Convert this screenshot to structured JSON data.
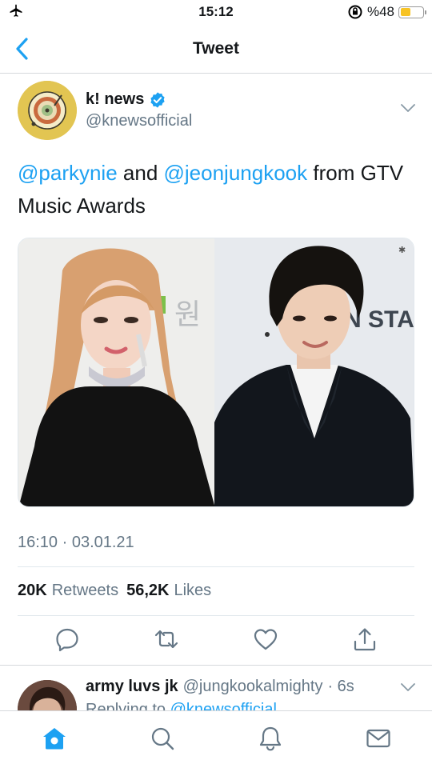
{
  "status_bar": {
    "time": "15:12",
    "battery_text": "%48",
    "battery_level": 0.48,
    "icons": [
      "airplane-icon",
      "rotation-lock-icon",
      "battery-icon"
    ]
  },
  "nav": {
    "title": "Tweet",
    "back_icon": "chevron-left-icon"
  },
  "tweet": {
    "author_name": "k! news",
    "author_handle": "@knewsofficial",
    "verified": true,
    "text_parts": [
      {
        "text": "@parkynie",
        "mention": true
      },
      {
        "text": " and ",
        "mention": false
      },
      {
        "text": "@jeonjungkook",
        "mention": true
      },
      {
        "text": " from GTV Music Awards",
        "mention": false
      }
    ],
    "timestamp": "16:10 · 03.01.21",
    "retweets_count": "20K",
    "retweets_label": "Retweets",
    "likes_count": "56,2K",
    "likes_label": "Likes",
    "photo_left_sign": "원",
    "photo_right_sign": "N STA"
  },
  "actions": [
    "reply-icon",
    "retweet-icon",
    "like-icon",
    "share-icon"
  ],
  "reply": {
    "author_name": "army luvs jk",
    "author_handle": "@jungkookalmighty",
    "age": "· 6s",
    "replying_prefix": "Replying to",
    "replying_to": "@knewsofficial"
  },
  "tab_bar": [
    "home-icon",
    "search-icon",
    "notifications-icon",
    "messages-icon"
  ],
  "colors": {
    "accent": "#1da1f2",
    "text": "#14171a",
    "secondary": "#657786",
    "border": "#e1e8ed"
  }
}
